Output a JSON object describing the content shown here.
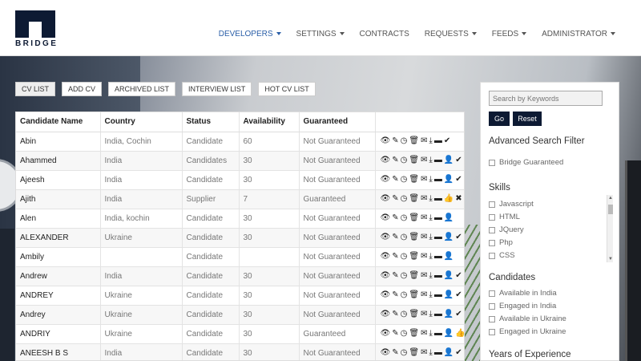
{
  "brand": {
    "name": "BRIDGE"
  },
  "nav": [
    {
      "label": "DEVELOPERS",
      "dropdown": true,
      "active": true
    },
    {
      "label": "SETTINGS",
      "dropdown": true
    },
    {
      "label": "CONTRACTS",
      "dropdown": false
    },
    {
      "label": "REQUESTS",
      "dropdown": true
    },
    {
      "label": "FEEDS",
      "dropdown": true
    },
    {
      "label": "ADMINISTRATOR",
      "dropdown": true
    }
  ],
  "tabs": [
    "CV LIST",
    "ADD CV",
    "ARCHIVED LIST",
    "INTERVIEW LIST",
    "HOT CV LIST"
  ],
  "table": {
    "headers": [
      "Candidate Name",
      "Country",
      "Status",
      "Availability",
      "Guaranteed",
      ""
    ],
    "rows": [
      {
        "name": "Abin",
        "country": "India, Cochin",
        "status": "Candidate",
        "availability": "60",
        "guaranteed": "Not Guaranteed",
        "icons": [
          "eye",
          "pencil",
          "clock",
          "trash",
          "envelope",
          "download",
          "folder",
          "check"
        ]
      },
      {
        "name": "Ahammed",
        "country": "India",
        "status": "Candidates",
        "availability": "30",
        "guaranteed": "Not Guaranteed",
        "icons": [
          "eye",
          "pencil",
          "clock",
          "trash",
          "envelope",
          "download",
          "folder",
          "user-plus",
          "check"
        ]
      },
      {
        "name": "Ajeesh",
        "country": "India",
        "status": "Candidate",
        "availability": "30",
        "guaranteed": "Not Guaranteed",
        "icons": [
          "eye",
          "pencil",
          "clock",
          "trash",
          "envelope",
          "download",
          "folder",
          "user-plus",
          "check"
        ]
      },
      {
        "name": "Ajith",
        "country": "India",
        "status": "Supplier",
        "availability": "7",
        "guaranteed": "Guaranteed",
        "icons": [
          "eye",
          "pencil",
          "clock",
          "trash",
          "envelope",
          "download",
          "folder",
          "thumbs-up",
          "cross"
        ]
      },
      {
        "name": "Alen",
        "country": "India, kochin",
        "status": "Candidate",
        "availability": "30",
        "guaranteed": "Not Guaranteed",
        "icons": [
          "eye",
          "pencil",
          "clock",
          "trash",
          "envelope",
          "download",
          "folder",
          "user-plus"
        ]
      },
      {
        "name": "ALEXANDER",
        "country": "Ukraine",
        "status": "Candidate",
        "availability": "30",
        "guaranteed": "Not Guaranteed",
        "icons": [
          "eye",
          "pencil",
          "clock",
          "trash",
          "envelope",
          "download",
          "folder",
          "user-plus",
          "check"
        ]
      },
      {
        "name": "Ambily",
        "country": "",
        "status": "Candidate",
        "availability": "",
        "guaranteed": "Not Guaranteed",
        "icons": [
          "eye",
          "pencil",
          "clock",
          "trash",
          "envelope",
          "download",
          "folder",
          "user-plus"
        ]
      },
      {
        "name": "Andrew",
        "country": "India",
        "status": "Candidate",
        "availability": "30",
        "guaranteed": "Not Guaranteed",
        "icons": [
          "eye",
          "pencil",
          "clock",
          "trash",
          "envelope",
          "download",
          "folder",
          "user-plus",
          "check"
        ]
      },
      {
        "name": "ANDREY",
        "country": "Ukraine",
        "status": "Candidate",
        "availability": "30",
        "guaranteed": "Not Guaranteed",
        "icons": [
          "eye",
          "pencil",
          "clock",
          "trash",
          "envelope",
          "download",
          "folder",
          "user-plus",
          "check"
        ]
      },
      {
        "name": "Andrey",
        "country": "Ukraine",
        "status": "Candidate",
        "availability": "30",
        "guaranteed": "Not Guaranteed",
        "icons": [
          "eye",
          "pencil",
          "clock",
          "trash",
          "envelope",
          "download",
          "folder",
          "user-plus",
          "check"
        ]
      },
      {
        "name": "ANDRIY",
        "country": "Ukraine",
        "status": "Candidate",
        "availability": "30",
        "guaranteed": "Guaranteed",
        "icons": [
          "eye",
          "pencil",
          "clock",
          "trash",
          "envelope",
          "download",
          "folder",
          "user-plus",
          "thumbs-up",
          "cross"
        ]
      },
      {
        "name": "ANEESH B S",
        "country": "India",
        "status": "Candidate",
        "availability": "30",
        "guaranteed": "Not Guaranteed",
        "icons": [
          "eye",
          "pencil",
          "clock",
          "trash",
          "envelope",
          "download",
          "folder",
          "user-plus",
          "check"
        ]
      }
    ]
  },
  "sidebar": {
    "search_placeholder": "Search by Keywords",
    "go_label": "Go",
    "reset_label": "Reset",
    "advanced_title": "Advanced Search Filter",
    "bridge_guaranteed": "Bridge Guaranteed",
    "skills_title": "Skills",
    "skills": [
      "Javascript",
      "HTML",
      "JQuery",
      "Php",
      "CSS"
    ],
    "candidates_title": "Candidates",
    "candidates": [
      "Available in India",
      "Engaged in India",
      "Available in Ukraine",
      "Engaged in Ukraine"
    ],
    "experience_title": "Years of Experience"
  },
  "colors": {
    "brand": "#0d1a33",
    "nav_active": "#2b5fa8"
  }
}
